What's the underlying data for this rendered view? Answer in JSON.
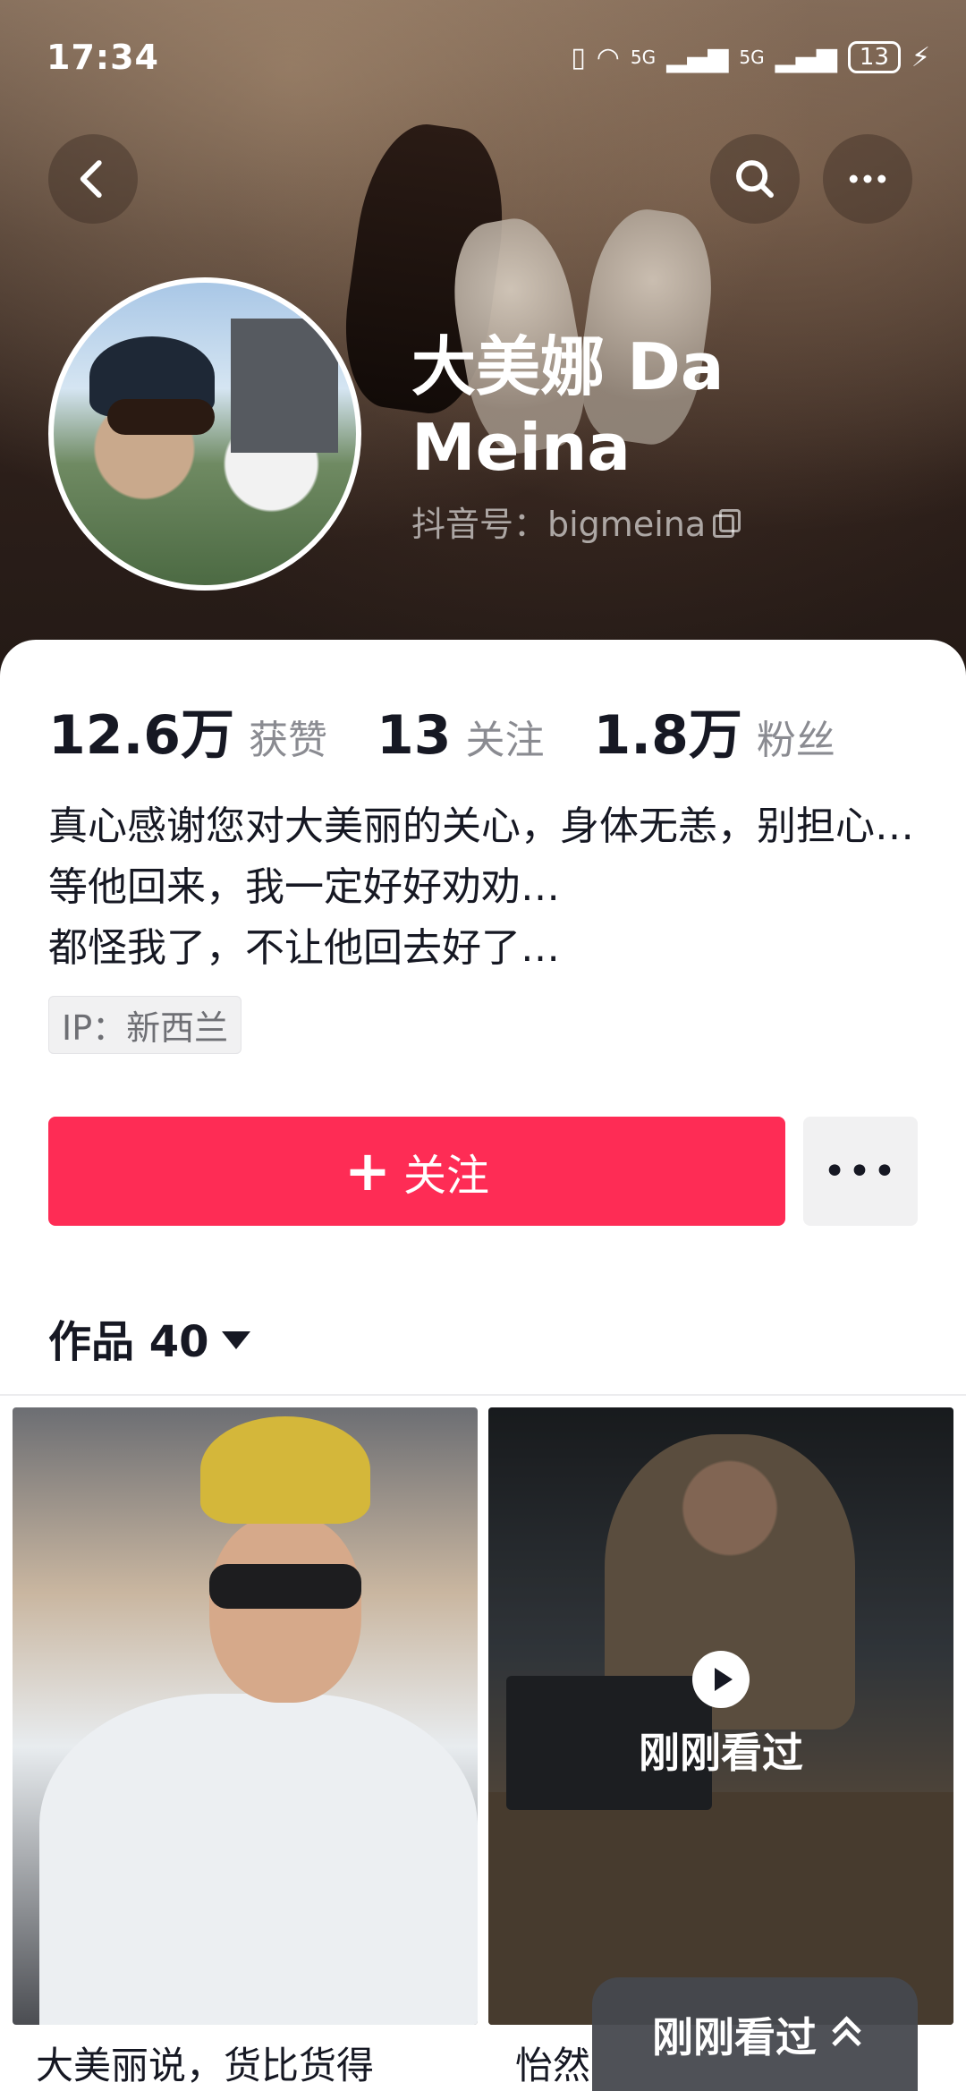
{
  "status_bar": {
    "time": "17:34",
    "signal_1": "5G",
    "signal_2": "5G",
    "battery": "13"
  },
  "profile": {
    "name": "大美娜 Da Meina",
    "douyin_id": "抖音号：bigmeina"
  },
  "stats": [
    {
      "value": "12.6万",
      "label": "获赞"
    },
    {
      "value": "13",
      "label": "关注"
    },
    {
      "value": "1.8万",
      "label": "粉丝"
    }
  ],
  "bio": {
    "line1": "真心感谢您对大美丽的关心，身体无恙，别担心…",
    "line2": "等他回来，我一定好好劝劝…",
    "line3": "都怪我了，不让他回去好了…"
  },
  "ip": "IP：新西兰",
  "actions": {
    "follow_label": "关注",
    "follow_icon": "+",
    "more_label": "•••"
  },
  "works_tab": {
    "label": "作品 40"
  },
  "videos": [
    {
      "caption": "大美丽说，货比货得"
    },
    {
      "caption": "怡然",
      "overlay": "刚刚看过"
    }
  ],
  "float_pill": {
    "label": "刚刚看过"
  },
  "colors": {
    "accent": "#fe2c55",
    "text": "#161823",
    "muted": "#8a8b91"
  }
}
